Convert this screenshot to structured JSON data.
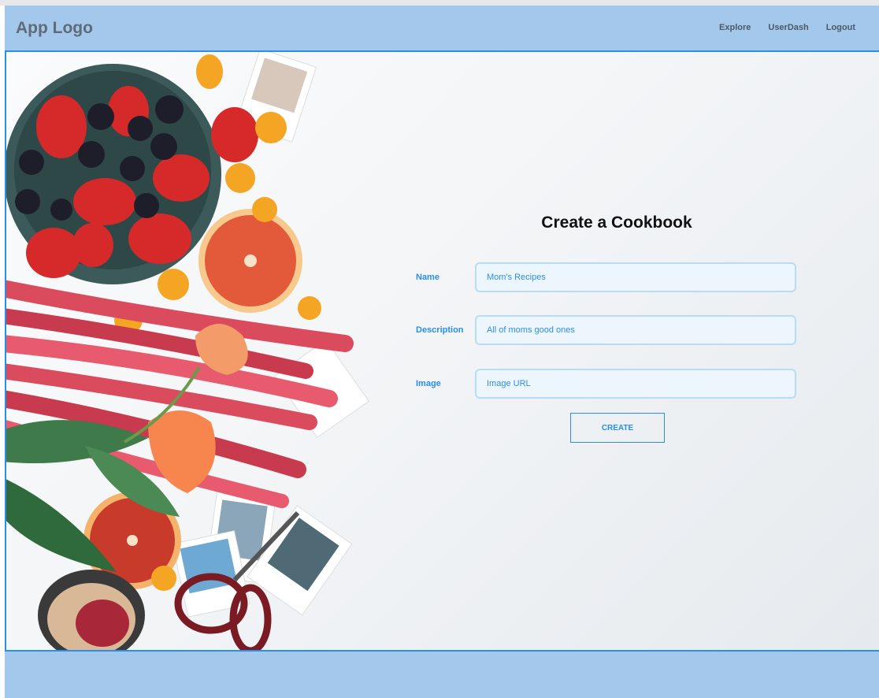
{
  "header": {
    "logo": "App Logo",
    "nav": [
      {
        "label": "Explore"
      },
      {
        "label": "UserDash"
      },
      {
        "label": "Logout"
      }
    ]
  },
  "form": {
    "title": "Create a Cookbook",
    "fields": [
      {
        "label": "Name",
        "value": "Mom's Recipes",
        "placeholder": ""
      },
      {
        "label": "Description",
        "value": "All of moms good ones",
        "placeholder": ""
      },
      {
        "label": "Image",
        "value": "",
        "placeholder": "Image URL"
      }
    ],
    "submit_label": "CREATE"
  },
  "colors": {
    "accent": "#2b8ee8",
    "header_bg": "#a3c8eb",
    "input_bg": "#eef6fd"
  }
}
